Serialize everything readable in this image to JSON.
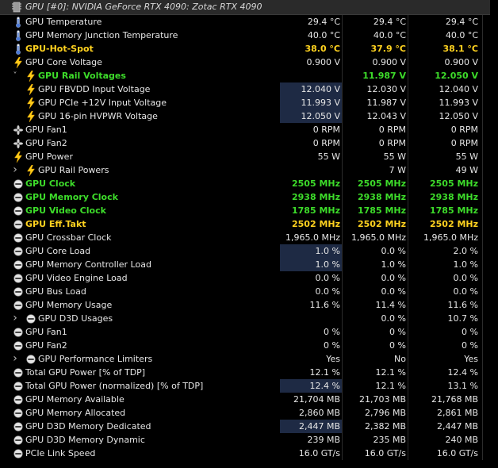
{
  "header": {
    "label": "GPU [#0]: NVIDIA GeForce RTX 4090: Zotac RTX 4090",
    "icon": "gpu-chip-icon"
  },
  "rows": [
    {
      "label": "GPU Temperature",
      "icon": "thermometer",
      "v": [
        "29.4 °C",
        "29.4 °C",
        "29.4 °C"
      ]
    },
    {
      "label": "GPU Memory Junction Temperature",
      "icon": "thermometer",
      "v": [
        "40.0 °C",
        "40.0 °C",
        "40.0 °C"
      ]
    },
    {
      "label": "GPU-Hot-Spot",
      "icon": "thermometer",
      "style": "yellow",
      "v": [
        "38.0 °C",
        "37.9 °C",
        "38.1 °C"
      ]
    },
    {
      "label": "GPU Core Voltage",
      "icon": "bolt",
      "v": [
        "0.900 V",
        "0.900 V",
        "0.900 V"
      ]
    },
    {
      "label": "GPU Rail Voltages",
      "icon": "bolt",
      "expand": "v",
      "style": "green",
      "indent": 1,
      "v": [
        "",
        "11.987 V",
        "12.050 V"
      ]
    },
    {
      "label": "GPU FBVDD Input Voltage",
      "icon": "bolt",
      "indent": 2,
      "hl": true,
      "v": [
        "12.040 V",
        "12.030 V",
        "12.040 V"
      ]
    },
    {
      "label": "GPU PCIe +12V Input Voltage",
      "icon": "bolt",
      "indent": 2,
      "hl": true,
      "v": [
        "11.993 V",
        "11.987 V",
        "11.993 V"
      ]
    },
    {
      "label": "GPU 16-pin HVPWR Voltage",
      "icon": "bolt",
      "indent": 2,
      "hl": true,
      "v": [
        "12.050 V",
        "12.043 V",
        "12.050 V"
      ]
    },
    {
      "label": "GPU Fan1",
      "icon": "fan",
      "v": [
        "0 RPM",
        "0 RPM",
        "0 RPM"
      ]
    },
    {
      "label": "GPU Fan2",
      "icon": "fan",
      "v": [
        "0 RPM",
        "0 RPM",
        "0 RPM"
      ]
    },
    {
      "label": "GPU Power",
      "icon": "bolt",
      "v": [
        "55 W",
        "55 W",
        "55 W"
      ]
    },
    {
      "label": "GPU Rail Powers",
      "icon": "bolt",
      "expand": ">",
      "indent": 1,
      "v": [
        "",
        "7 W",
        "49 W"
      ]
    },
    {
      "label": "GPU Clock",
      "icon": "gauge",
      "style": "green",
      "v": [
        "2505 MHz",
        "2505 MHz",
        "2505 MHz"
      ]
    },
    {
      "label": "GPU Memory Clock",
      "icon": "gauge",
      "style": "green",
      "v": [
        "2938 MHz",
        "2938 MHz",
        "2938 MHz"
      ]
    },
    {
      "label": "GPU Video Clock",
      "icon": "gauge",
      "style": "green",
      "v": [
        "1785 MHz",
        "1785 MHz",
        "1785 MHz"
      ]
    },
    {
      "label": "GPU Eff.Takt",
      "icon": "gauge",
      "style": "yellow",
      "v": [
        "2502 MHz",
        "2502 MHz",
        "2502 MHz"
      ]
    },
    {
      "label": "GPU Crossbar Clock",
      "icon": "gauge",
      "v": [
        "1,965.0 MHz",
        "1,965.0 MHz",
        "1,965.0 MHz"
      ]
    },
    {
      "label": "GPU Core Load",
      "icon": "gauge",
      "hl": true,
      "v": [
        "1.0 %",
        "0.0 %",
        "2.0 %"
      ]
    },
    {
      "label": "GPU Memory Controller Load",
      "icon": "gauge",
      "hl": true,
      "v": [
        "1.0 %",
        "1.0 %",
        "1.0 %"
      ]
    },
    {
      "label": "GPU Video Engine Load",
      "icon": "gauge",
      "v": [
        "0.0 %",
        "0.0 %",
        "0.0 %"
      ]
    },
    {
      "label": "GPU Bus Load",
      "icon": "gauge",
      "v": [
        "0.0 %",
        "0.0 %",
        "0.0 %"
      ]
    },
    {
      "label": "GPU Memory Usage",
      "icon": "gauge",
      "v": [
        "11.6 %",
        "11.4 %",
        "11.6 %"
      ]
    },
    {
      "label": "GPU D3D Usages",
      "icon": "gauge",
      "expand": ">",
      "indent": 1,
      "v": [
        "",
        "0.0 %",
        "10.7 %"
      ]
    },
    {
      "label": "GPU Fan1",
      "icon": "gauge",
      "v": [
        "0 %",
        "0 %",
        "0 %"
      ]
    },
    {
      "label": "GPU Fan2",
      "icon": "gauge",
      "v": [
        "0 %",
        "0 %",
        "0 %"
      ]
    },
    {
      "label": "GPU Performance Limiters",
      "icon": "gauge",
      "expand": ">",
      "indent": 1,
      "v": [
        "Yes",
        "No",
        "Yes"
      ]
    },
    {
      "label": "Total GPU Power [% of TDP]",
      "icon": "gauge",
      "v": [
        "12.1 %",
        "12.1 %",
        "12.4 %"
      ]
    },
    {
      "label": "Total GPU Power (normalized) [% of TDP]",
      "icon": "gauge",
      "hl": true,
      "v": [
        "12.4 %",
        "12.1 %",
        "13.1 %"
      ]
    },
    {
      "label": "GPU Memory Available",
      "icon": "gauge",
      "v": [
        "21,704 MB",
        "21,703 MB",
        "21,768 MB"
      ]
    },
    {
      "label": "GPU Memory Allocated",
      "icon": "gauge",
      "v": [
        "2,860 MB",
        "2,796 MB",
        "2,861 MB"
      ]
    },
    {
      "label": "GPU D3D Memory Dedicated",
      "icon": "gauge",
      "hl": true,
      "v": [
        "2,447 MB",
        "2,382 MB",
        "2,447 MB"
      ]
    },
    {
      "label": "GPU D3D Memory Dynamic",
      "icon": "gauge",
      "v": [
        "239 MB",
        "235 MB",
        "240 MB"
      ]
    },
    {
      "label": "PCIe Link Speed",
      "icon": "gauge",
      "v": [
        "16.0 GT/s",
        "16.0 GT/s",
        "16.0 GT/s"
      ]
    }
  ],
  "colors": {
    "background": "#000000",
    "text": "#e6e6e6",
    "green_highlight": "#3ddc2a",
    "yellow_highlight": "#ffd21f",
    "selected_cell": "#1e2a44",
    "header_bg": "#2a2a2a"
  }
}
